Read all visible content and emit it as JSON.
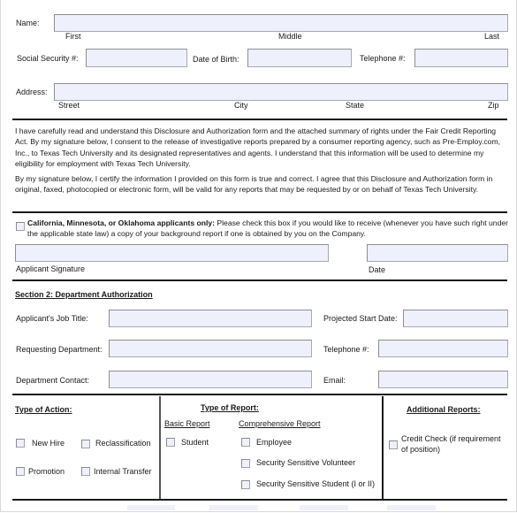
{
  "applicant": {
    "name_label": "Name:",
    "name_sublabels": {
      "first": "First",
      "middle": "Middle",
      "last": "Last"
    },
    "ssn_label": "Social Security #:",
    "dob_label": "Date of Birth:",
    "telephone_label": "Telephone #:",
    "address_label": "Address:",
    "address_sublabels": {
      "street": "Street",
      "city": "City",
      "state": "State",
      "zip": "Zip"
    },
    "fields": {
      "name": "",
      "ssn": "",
      "dob": "",
      "telephone": "",
      "address": ""
    }
  },
  "disclosure": {
    "paragraph1": "I have carefully read and understand this Disclosure and Authorization form and the attached summary of rights under the Fair Credit Reporting Act. By my signature below, I consent to the release of investigative reports prepared by a consumer reporting agency, such as Pre-Employ.com, Inc., to Texas Tech University and its designated representatives and agents. I understand that this information will be used to determine my eligibility for employment with Texas Tech University.",
    "paragraph2": "By my signature below, I certify the information I provided on this form is true and correct. I agree that this Disclosure and Authorization form in original, faxed, photocopied or electronic form, will be valid for any reports that may be requested by or on behalf of Texas Tech University."
  },
  "state_copy": {
    "bold_text": "California, Minnesota, or Oklahoma applicants only:",
    "text": " Please check this box if you would like to receive (whenever you have such right under the applicable state law) a copy of your background report if one is obtained by you on the Company.",
    "checked": false
  },
  "signature": {
    "signature_label": "Applicant Signature",
    "date_label": "Date",
    "signature_value": "",
    "date_value": ""
  },
  "section2": {
    "title": "Section 2: Department Authorization",
    "job_title_label": "Applicant's Job Title:",
    "start_date_label": "Projected Start Date:",
    "requesting_dept_label": "Requesting Department:",
    "telephone_label": "Telephone #:",
    "dept_contact_label": "Department Contact:",
    "email_label": "Email:"
  },
  "type_of_action": {
    "title": "Type of Action:",
    "options": [
      {
        "label": "New Hire",
        "checked": false
      },
      {
        "label": "Reclassification",
        "checked": false
      },
      {
        "label": "Promotion",
        "checked": false
      },
      {
        "label": "Internal Transfer",
        "checked": false
      }
    ]
  },
  "type_of_report": {
    "title": "Type of Report:",
    "basic_title": "Basic Report",
    "basic_options": [
      {
        "label": "Student",
        "checked": false
      }
    ],
    "comprehensive_title": "Comprehensive Report",
    "comprehensive_options": [
      {
        "label": "Employee",
        "checked": false
      },
      {
        "label": "Security Sensitive Volunteer",
        "checked": false
      },
      {
        "label": "Security Sensitive Student (I or II)",
        "checked": false
      }
    ]
  },
  "additional_reports": {
    "title": "Additional Reports:",
    "options": [
      {
        "label": "Credit Check (if requirement of position)",
        "checked": false
      }
    ]
  },
  "colors": {
    "field_fill": "#eef0fb",
    "field_border": "#a9a9ae",
    "rule": "#1a1a1a"
  }
}
